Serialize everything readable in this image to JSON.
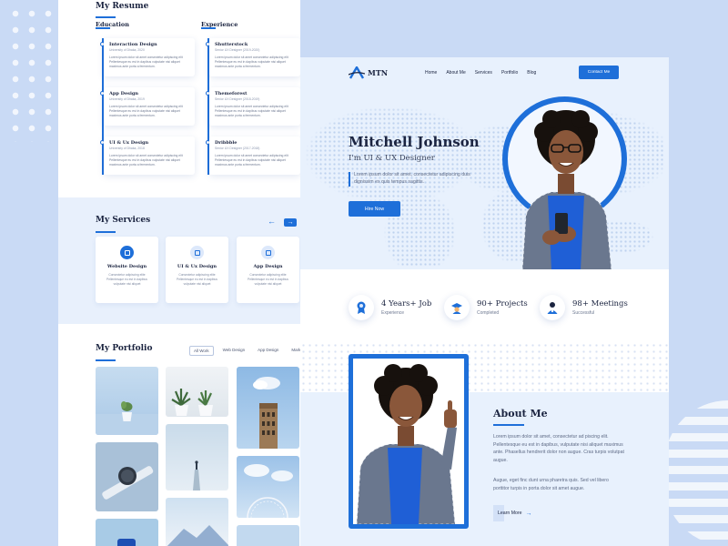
{
  "colors": {
    "accent": "#1e6fd9",
    "background": "#c9daf5",
    "hero_bg": "#e8f1fd",
    "heading": "#1b2440"
  },
  "resume": {
    "title": "My Resume",
    "education": {
      "heading": "Education",
      "items": [
        {
          "title": "Interaction Design",
          "sub": "University of Dhaka, 2020",
          "body": "Lorem ipsum dolor sit amet consectetur adipiscing elit Pellentesque eu est in dapibus vulputate nisi aliquet maximus ante porta a fermentum."
        },
        {
          "title": "App Design",
          "sub": "University of Dhaka, 2019",
          "body": "Lorem ipsum dolor sit amet consectetur adipiscing elit Pellentesque eu est in dapibus vulputate nisi aliquet maximus ante porta a fermentum."
        },
        {
          "title": "UI & Ux Design",
          "sub": "University of Dhaka, 2018",
          "body": "Lorem ipsum dolor sit amet consectetur adipiscing elit Pellentesque eu est in dapibus vulputate nisi aliquet maximus ante porta a fermentum."
        }
      ]
    },
    "experience": {
      "heading": "Experience",
      "items": [
        {
          "title": "Shutterstock",
          "sub": "Senior UX Designer (2019-2020)",
          "body": "Lorem ipsum dolor sit amet consectetur adipiscing elit Pellentesque eu est in dapibus vulputate nisi aliquet maximus ante porta a fermentum."
        },
        {
          "title": "Themeforest",
          "sub": "Senior UX Designer (2018-2019)",
          "body": "Lorem ipsum dolor sit amet consectetur adipiscing elit Pellentesque eu est in dapibus vulputate nisi aliquet maximus ante porta a fermentum."
        },
        {
          "title": "Dribbble",
          "sub": "Senior UX Designer (2017-2018)",
          "body": "Lorem ipsum dolor sit amet consectetur adipiscing elit Pellentesque eu est in dapibus vulputate nisi aliquet maximus ante porta a fermentum."
        }
      ]
    }
  },
  "services": {
    "title": "My Services",
    "prev_icon": "arrow-left-icon",
    "next_icon": "arrow-right-icon",
    "prev_glyph": "←",
    "next_glyph": "→",
    "items": [
      {
        "title": "Website Design",
        "body": "Consectetur adipiscing elite Pellentesque eu est in dapibus vulputate nisi aliquet",
        "icon": "monitor-icon",
        "icon_bg": "#1e6fd9",
        "icon_fg": "#ffffff"
      },
      {
        "title": "UI & Ux Design",
        "body": "Consectetur adipiscing elite Pellentesque eu est in dapibus vulputate nisi aliquet",
        "icon": "layout-icon",
        "icon_bg": "#dce8fb",
        "icon_fg": "#1e6fd9"
      },
      {
        "title": "App Design",
        "body": "Consectetur adipiscing elite Pellentesque eu est in dapibus vulputate nisi aliquet",
        "icon": "phone-icon",
        "icon_bg": "#dce8fb",
        "icon_fg": "#1e6fd9"
      }
    ]
  },
  "portfolio": {
    "title": "My Portfolio",
    "filters": [
      "All Work",
      "Web Design",
      "App Design",
      "Marketing"
    ],
    "active_filter": "All Work"
  },
  "nav": {
    "logo": "MTN",
    "links": [
      "Home",
      "About Me",
      "Services",
      "Portfolio",
      "Blog"
    ],
    "cta": "Contact Me"
  },
  "hero": {
    "name": "Mitchell Johnson",
    "role": "I'm UI & UX Designer",
    "desc": "Lorem ipsum dolor sit amet, consectetur adipiscing duis dignissim ex quis tempus sagittis.",
    "button": "Hire Now"
  },
  "stats": [
    {
      "value": "4 Years+ Job",
      "label": "Experience",
      "icon": "award-icon"
    },
    {
      "value": "90+ Projects",
      "label": "Completed",
      "icon": "graduation-icon"
    },
    {
      "value": "98+ Meetings",
      "label": "Successful",
      "icon": "user-icon"
    }
  ],
  "about": {
    "title": "About Me",
    "p1": "Lorem ipsum dolor sit amet, consectetur ad piscing elit. Pellentesque eu est in dapibus, vulputate nisi aliquet maximus ante. Phasellus hendrerit dolor non augue. Cras turpis volutpat augue.",
    "p2": "Augue, eget finc dunt urna pharetra quis. Sed vel libero porttitor turpis in porta dolor sit amet augue.",
    "button": "Learn More",
    "button_arrow": "→"
  }
}
